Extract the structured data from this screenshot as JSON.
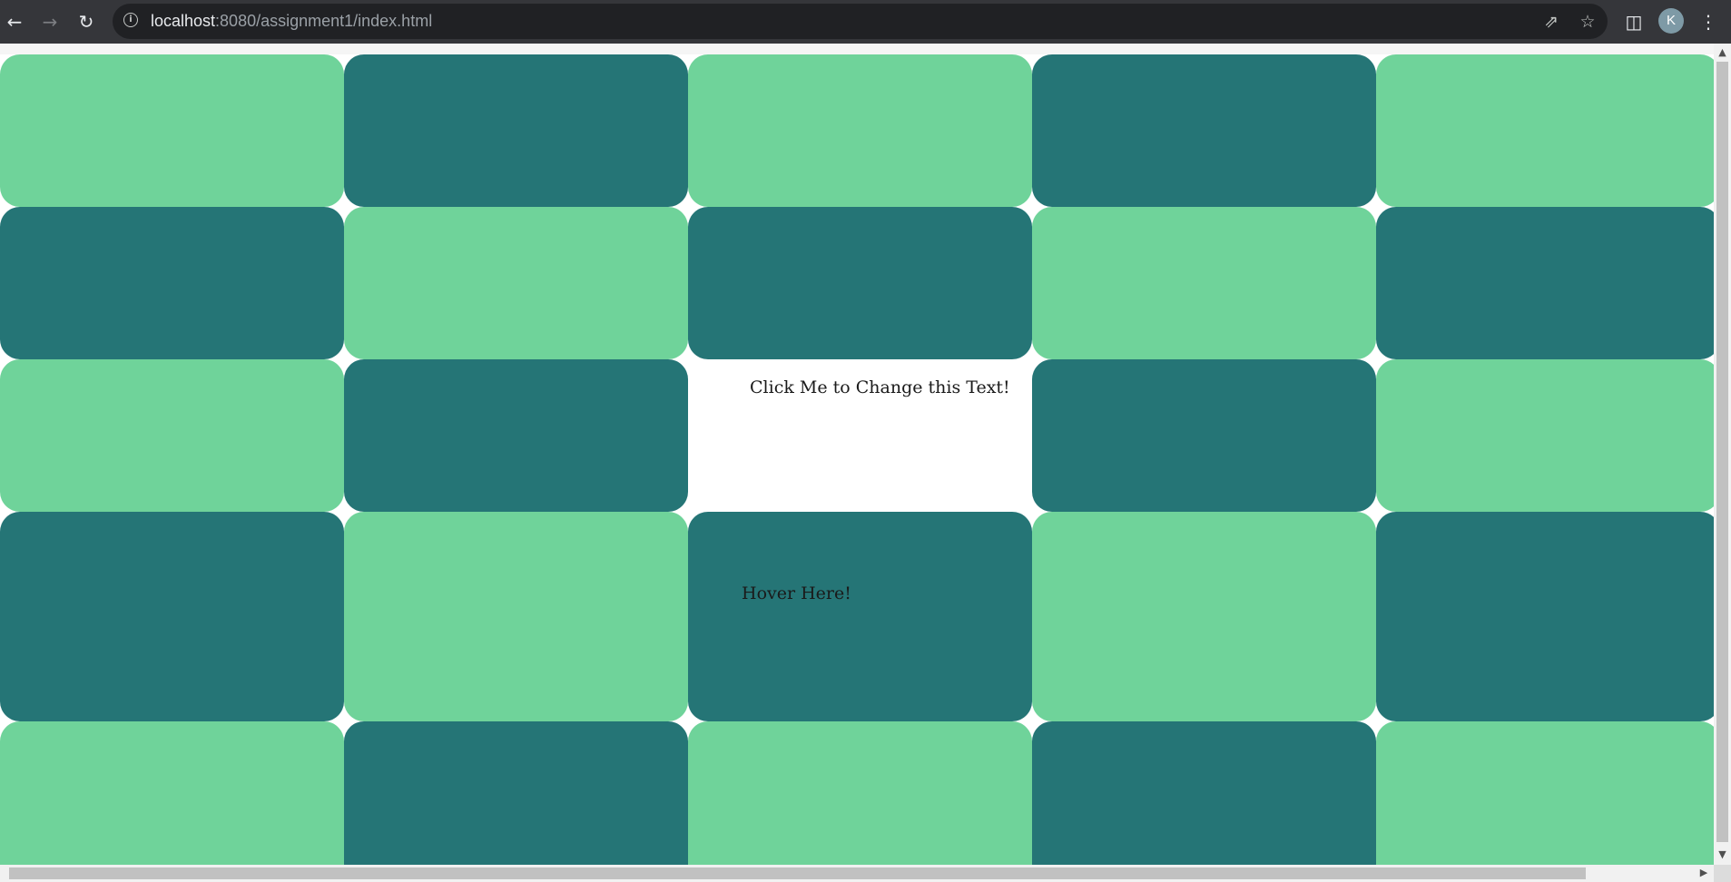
{
  "browser": {
    "url_host": "localhost",
    "url_rest": ":8080/assignment1/index.html",
    "avatar_letter": "K",
    "icons": {
      "back": "arrow-left-icon",
      "forward": "arrow-right-icon",
      "reload": "reload-icon",
      "info": "info-icon",
      "share": "share-icon",
      "bookmark": "star-icon",
      "side_panel": "side-panel-icon",
      "menu": "kebab-menu-icon"
    }
  },
  "colors": {
    "light": "#6fd39a",
    "dark": "#257576",
    "white": "#ffffff"
  },
  "grid": {
    "click_cell_text": "Click Me to Change this Text!",
    "hover_cell_text": "Hover Here!"
  }
}
